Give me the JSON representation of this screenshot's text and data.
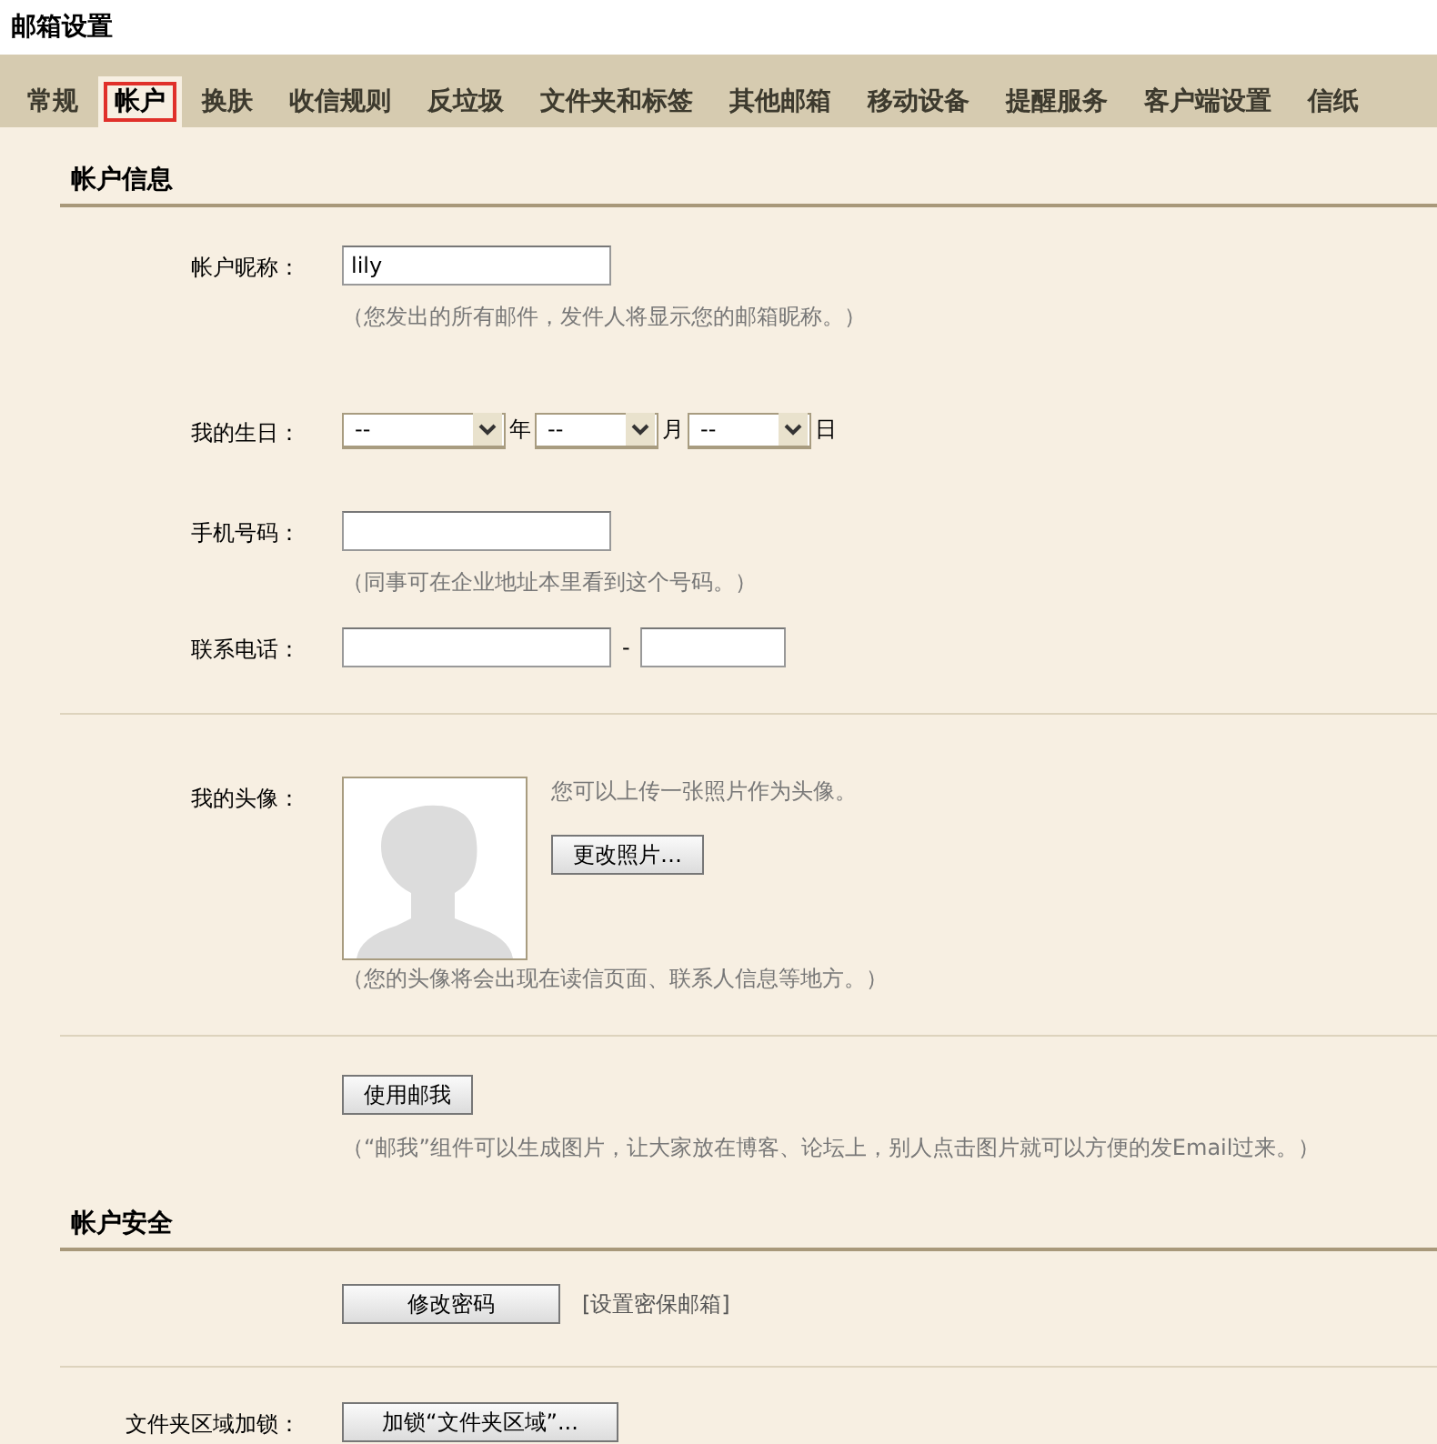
{
  "page_title": "邮箱设置",
  "tabs": [
    {
      "label": "常规",
      "selected": false
    },
    {
      "label": "帐户",
      "selected": true
    },
    {
      "label": "换肤",
      "selected": false
    },
    {
      "label": "收信规则",
      "selected": false
    },
    {
      "label": "反垃圾",
      "selected": false
    },
    {
      "label": "文件夹和标签",
      "selected": false
    },
    {
      "label": "其他邮箱",
      "selected": false
    },
    {
      "label": "移动设备",
      "selected": false
    },
    {
      "label": "提醒服务",
      "selected": false
    },
    {
      "label": "客户端设置",
      "selected": false
    },
    {
      "label": "信纸",
      "selected": false
    }
  ],
  "account_info": {
    "heading": "帐户信息",
    "nickname": {
      "label": "帐户昵称：",
      "value": "lily",
      "hint": "（您发出的所有邮件，发件人将显示您的邮箱昵称。）"
    },
    "birthday": {
      "label": "我的生日：",
      "fields": [
        {
          "value": "--",
          "unit": "年"
        },
        {
          "value": "--",
          "unit": "月"
        },
        {
          "value": "--",
          "unit": "日"
        }
      ]
    },
    "mobile": {
      "label": "手机号码：",
      "hint": "（同事可在企业地址本里看到这个号码。）"
    },
    "phone": {
      "label": "联系电话：",
      "separator": "-"
    },
    "avatar": {
      "label": "我的头像：",
      "note": "您可以上传一张照片作为头像。",
      "button": "更改照片…",
      "hint": "（您的头像将会出现在读信页面、联系人信息等地方。）"
    },
    "mailme": {
      "button": "使用邮我",
      "hint": "（“邮我”组件可以生成图片，让大家放在博客、论坛上，别人点击图片就可以方便的发Email过来。）"
    }
  },
  "account_security": {
    "heading": "帐户安全",
    "password_button": "修改密码",
    "security_link": "[设置密保邮箱]",
    "folder_lock": {
      "label": "文件夹区域加锁：",
      "button": "加锁“文件夹区域”..."
    }
  }
}
